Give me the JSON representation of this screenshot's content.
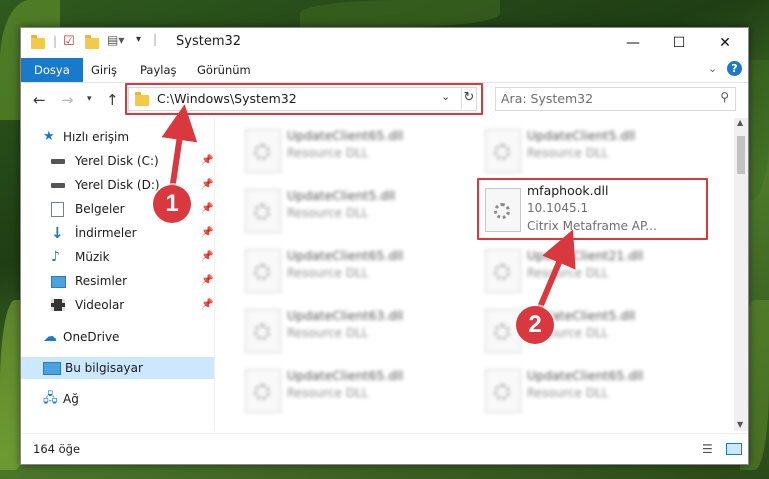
{
  "window": {
    "title": "System32",
    "controls": {
      "minimize": "—",
      "maximize": "☐",
      "close": "✕"
    }
  },
  "ribbon": {
    "tabs": [
      "Dosya",
      "Giriş",
      "Paylaş",
      "Görünüm"
    ],
    "active_tab": "Dosya"
  },
  "nav": {
    "address": "C:\\Windows\\System32",
    "search_placeholder": "Ara: System32"
  },
  "sidebar": {
    "items": [
      {
        "label": "Hızlı erişim",
        "icon": "star-icon"
      },
      {
        "label": "Yerel Disk (C:)",
        "icon": "drive-icon",
        "pinned": true
      },
      {
        "label": "Yerel Disk (D:)",
        "icon": "drive-icon",
        "pinned": true
      },
      {
        "label": "Belgeler",
        "icon": "document-icon",
        "pinned": true
      },
      {
        "label": "İndirmeler",
        "icon": "download-icon",
        "pinned": true
      },
      {
        "label": "Müzik",
        "icon": "music-icon",
        "pinned": true
      },
      {
        "label": "Resimler",
        "icon": "pictures-icon",
        "pinned": true
      },
      {
        "label": "Videolar",
        "icon": "video-icon",
        "pinned": true
      },
      {
        "label": "OneDrive",
        "icon": "cloud-icon"
      },
      {
        "label": "Bu bilgisayar",
        "icon": "computer-icon",
        "selected": true
      },
      {
        "label": "Ağ",
        "icon": "network-icon"
      }
    ]
  },
  "files": {
    "left_column": [
      {
        "name": "UpdateClient65.dll",
        "type": "Resource DLL"
      },
      {
        "name": "UpdateClient5.dll",
        "type": "Resource DLL"
      },
      {
        "name": "UpdateClient65.dll",
        "type": "Resource DLL"
      },
      {
        "name": "UpdateClient63.dll",
        "type": "Resource DLL"
      },
      {
        "name": "UpdateClient65.dll",
        "type": "Resource DLL"
      }
    ],
    "right_column": [
      {
        "name": "UpdateClient5.dll",
        "type": "Resource DLL"
      },
      {
        "name": "UpdateClient21.dll",
        "type": "Resource DLL"
      },
      {
        "name": "UpdateClient5.dll",
        "type": "Resource DLL"
      },
      {
        "name": "UpdateClient65.dll",
        "type": "Resource DLL"
      }
    ],
    "highlighted": {
      "name": "mfaphook.dll",
      "version": "10.1045.1",
      "description": "Citrix Metaframe AP..."
    }
  },
  "status": {
    "item_count": "164 öğe"
  },
  "annotations": {
    "badge1": "1",
    "badge2": "2"
  },
  "colors": {
    "accent": "#1979ca",
    "highlight": "#d9393e",
    "selected": "#cce8ff"
  }
}
